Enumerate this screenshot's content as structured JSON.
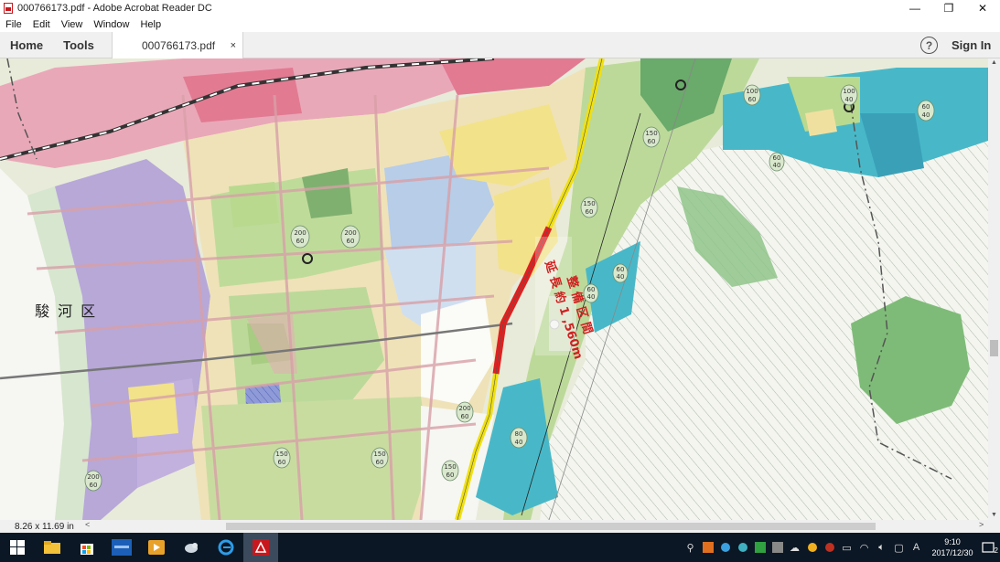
{
  "window": {
    "title": "000766173.pdf - Adobe Acrobat Reader DC",
    "minimize": "—",
    "restore": "❐",
    "close": "✕"
  },
  "menu": {
    "items": [
      "File",
      "Edit",
      "View",
      "Window",
      "Help"
    ]
  },
  "tabs": {
    "home": "Home",
    "tools": "Tools",
    "document": "000766173.pdf",
    "close": "×",
    "help": "?",
    "sign_in": "Sign In"
  },
  "map": {
    "ward_label": "駿 河 区",
    "section_label_1": "整 備 区 間",
    "section_label_2": "延 長 約 1 ,560m",
    "zone_values": [
      "100\n60",
      "60\n40",
      "150\n60",
      "200\n60",
      "80\n40",
      "100\n40"
    ],
    "colors": {
      "commercial": "#e9a8b8",
      "residential_yellow": "#f2e28a",
      "residential_green": "#b9d98f",
      "industrial_purple": "#b7a8d8",
      "cyan_zone": "#48b8c8",
      "red_route": "#e02020",
      "yellow_route": "#f0e010"
    }
  },
  "status": {
    "page_size": "8.26 x 11.69 in",
    "left_arrow": "<",
    "right_arrow": ">"
  },
  "taskbar": {
    "lang": "A",
    "time": "9:10",
    "date": "2017/12/30",
    "notifications": "2"
  }
}
